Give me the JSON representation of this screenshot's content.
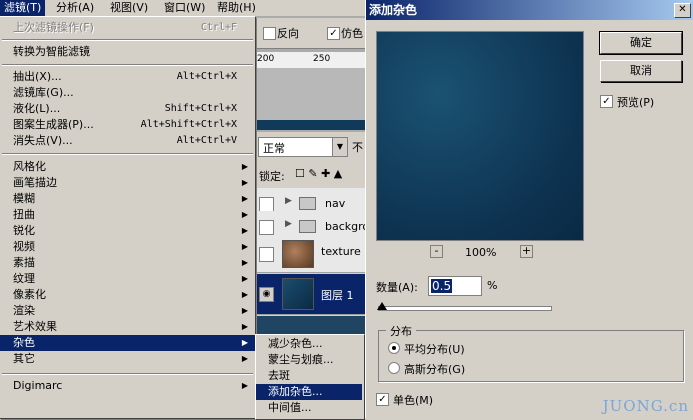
{
  "menubar": [
    {
      "label": "滤镜(T)",
      "active": true
    },
    {
      "label": "分析(A)"
    },
    {
      "label": "视图(V)"
    },
    {
      "label": "窗口(W)"
    },
    {
      "label": "帮助(H)"
    }
  ],
  "filter_menu": {
    "items": [
      {
        "label": "上次滤镜操作(F)",
        "shortcut": "Ctrl+F",
        "disabled": true
      },
      {
        "label": "转换为智能滤镜"
      },
      {
        "label": "抽出(X)...",
        "shortcut": "Alt+Ctrl+X"
      },
      {
        "label": "滤镜库(G)..."
      },
      {
        "label": "液化(L)...",
        "shortcut": "Shift+Ctrl+X"
      },
      {
        "label": "图案生成器(P)...",
        "shortcut": "Alt+Shift+Ctrl+X"
      },
      {
        "label": "消失点(V)...",
        "shortcut": "Alt+Ctrl+V"
      },
      {
        "label": "风格化"
      },
      {
        "label": "画笔描边"
      },
      {
        "label": "模糊"
      },
      {
        "label": "扭曲"
      },
      {
        "label": "锐化"
      },
      {
        "label": "视频"
      },
      {
        "label": "素描"
      },
      {
        "label": "纹理"
      },
      {
        "label": "像素化"
      },
      {
        "label": "渲染"
      },
      {
        "label": "艺术效果"
      },
      {
        "label": "杂色"
      },
      {
        "label": "其它"
      },
      {
        "label": "Digimarc"
      }
    ]
  },
  "noise_submenu": [
    {
      "label": "减少杂色..."
    },
    {
      "label": "蒙尘与划痕..."
    },
    {
      "label": "去斑"
    },
    {
      "label": "添加杂色..."
    },
    {
      "label": "中间值..."
    }
  ],
  "options_bar": {
    "reverse": "反向",
    "simulate": "仿色"
  },
  "ruler": {
    "tick1": "200",
    "tick2": "250"
  },
  "layers_panel": {
    "blend_mode": "正常",
    "opacity_label": "不",
    "lock_label": "锁定:",
    "layers": [
      {
        "name": "nav",
        "type": "folder"
      },
      {
        "name": "backgro",
        "type": "folder"
      },
      {
        "name": "texture",
        "type": "layer"
      },
      {
        "name": "图层 1",
        "type": "layer",
        "selected": true
      }
    ]
  },
  "dialog": {
    "title": "添加杂色",
    "ok_label": "确定",
    "cancel_label": "取消",
    "preview_label": "预览(P)",
    "preview_checked": true,
    "zoom_level": "100%",
    "amount_label": "数量(A):",
    "amount_value": "0.5",
    "amount_unit": "%",
    "distribution_title": "分布",
    "uniform_label": "平均分布(U)",
    "gaussian_label": "高斯分布(G)",
    "distribution_selected": "uniform",
    "mono_label": "单色(M)",
    "mono_checked": true
  },
  "watermark": "JUONG.cn"
}
